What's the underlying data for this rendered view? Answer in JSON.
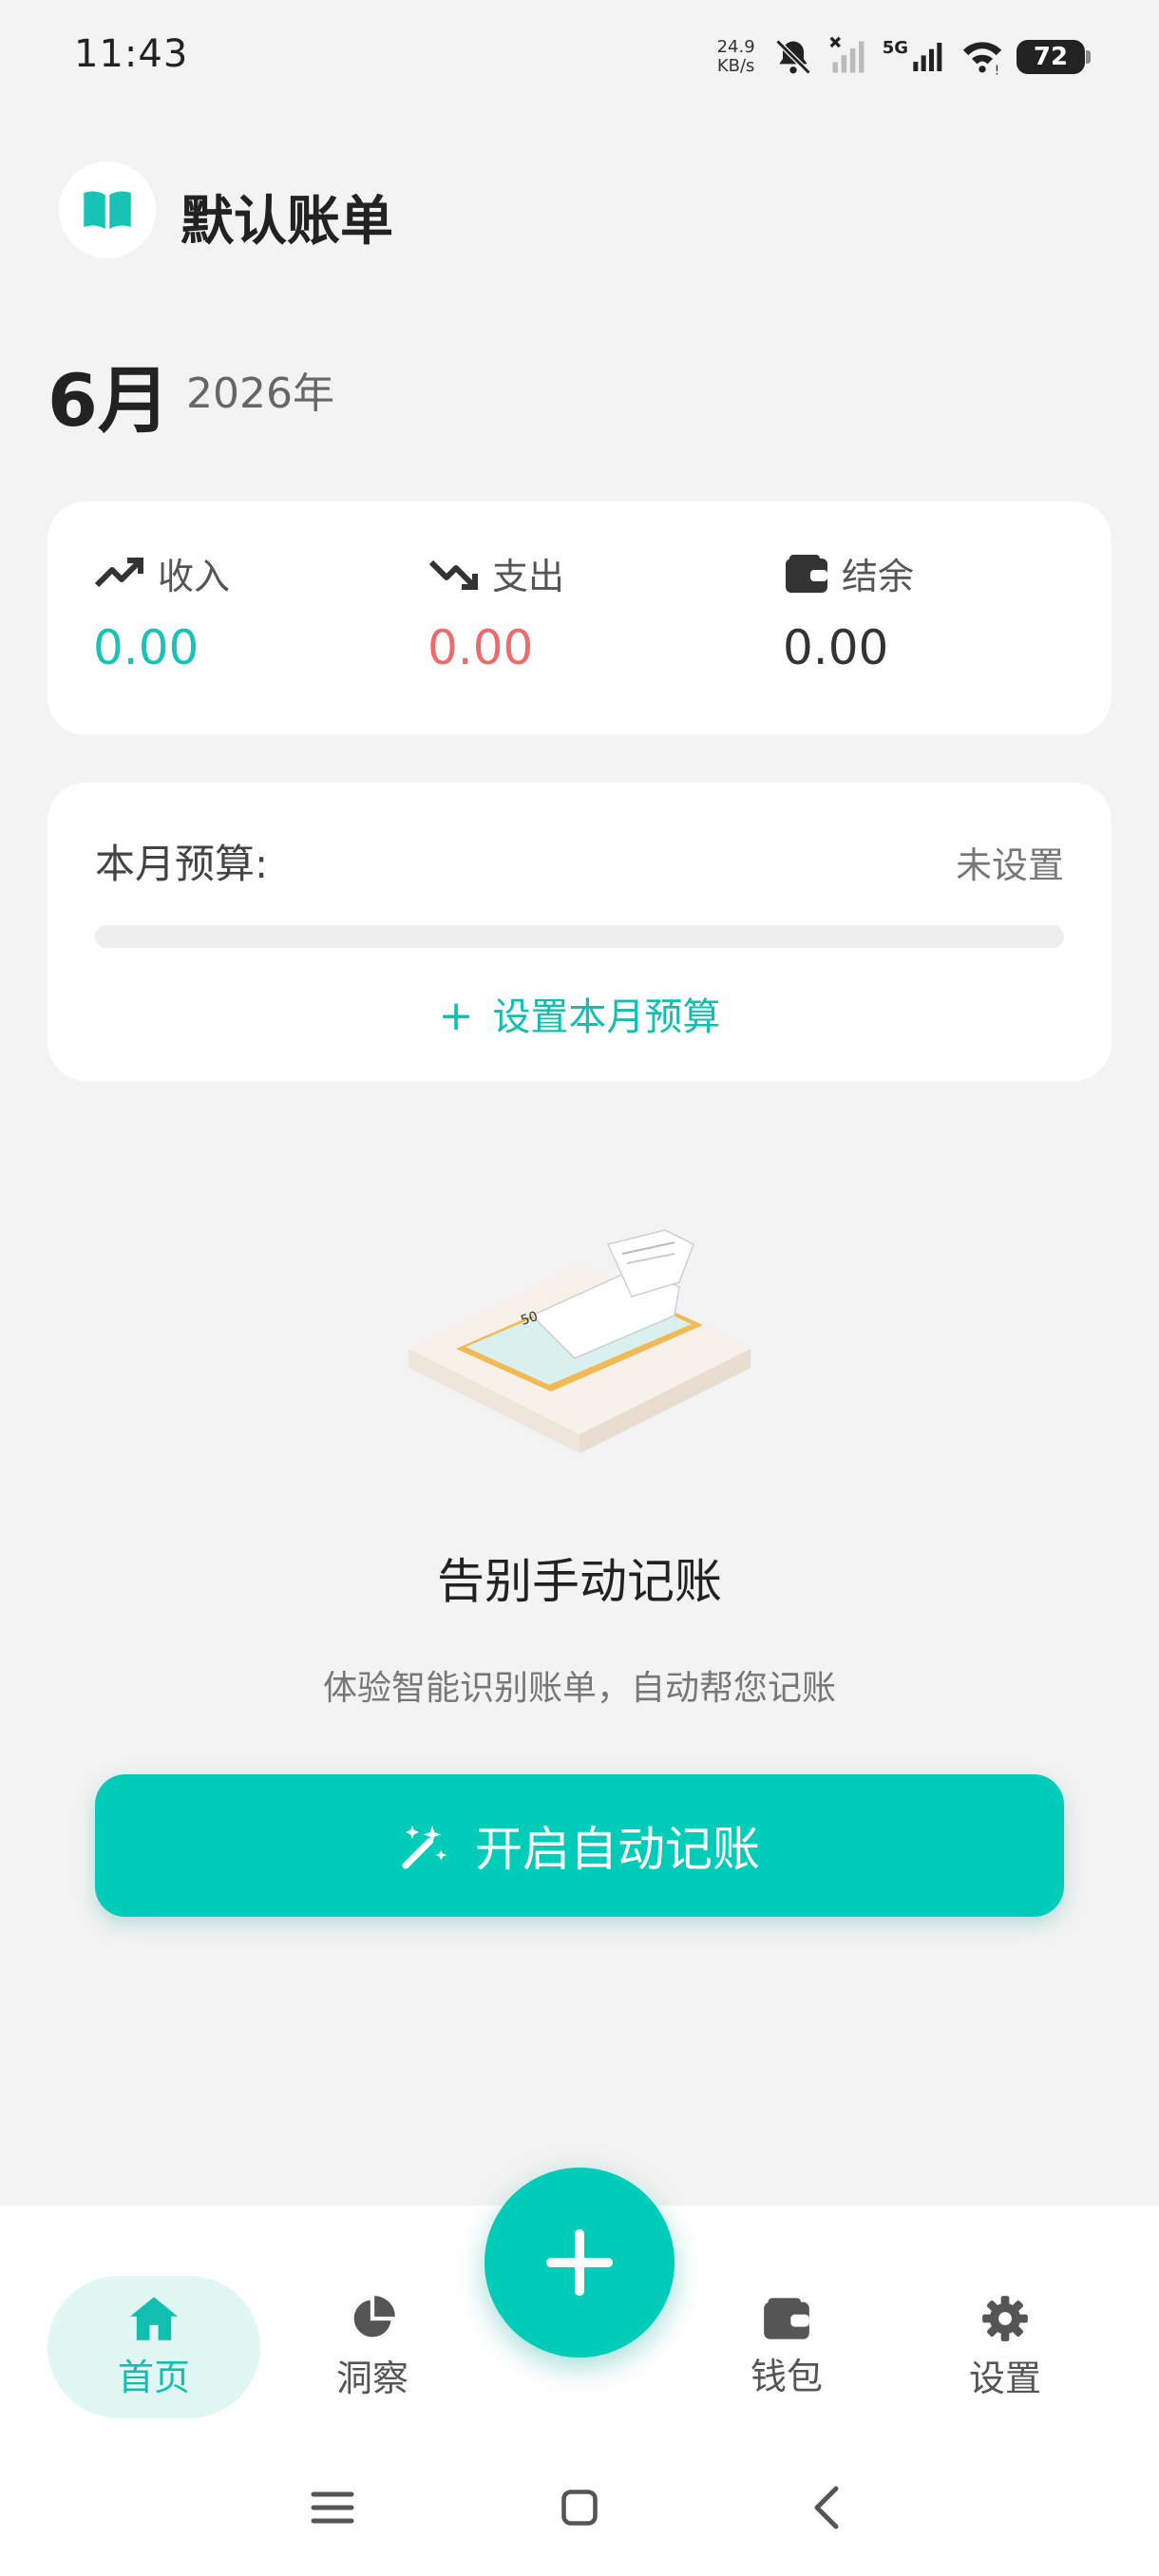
{
  "status_bar": {
    "time": "11:43",
    "net_speed_value": "24.9",
    "net_speed_unit": "KB/s",
    "network": "5G",
    "battery": "72"
  },
  "header": {
    "book_name": "默认账单",
    "book_icon": "open-book-icon"
  },
  "period": {
    "month": "6月",
    "year": "2026年"
  },
  "summary": {
    "income_label": "收入",
    "income_value": "0.00",
    "expense_label": "支出",
    "expense_value": "0.00",
    "balance_label": "结余",
    "balance_value": "0.00"
  },
  "budget": {
    "label": "本月预算:",
    "state": "未设置",
    "progress": 0,
    "action_label": "设置本月预算"
  },
  "promo": {
    "title": "告别手动记账",
    "subtitle": "体验智能识别账单，自动帮您记账",
    "button_label": "开启自动记账"
  },
  "nav": {
    "home": "首页",
    "insights": "洞察",
    "wallet": "钱包",
    "settings": "设置"
  },
  "colors": {
    "accent": "#00cdb9",
    "income": "#16c3b4",
    "expense": "#ef6b6b",
    "background": "#f3f3f3"
  }
}
